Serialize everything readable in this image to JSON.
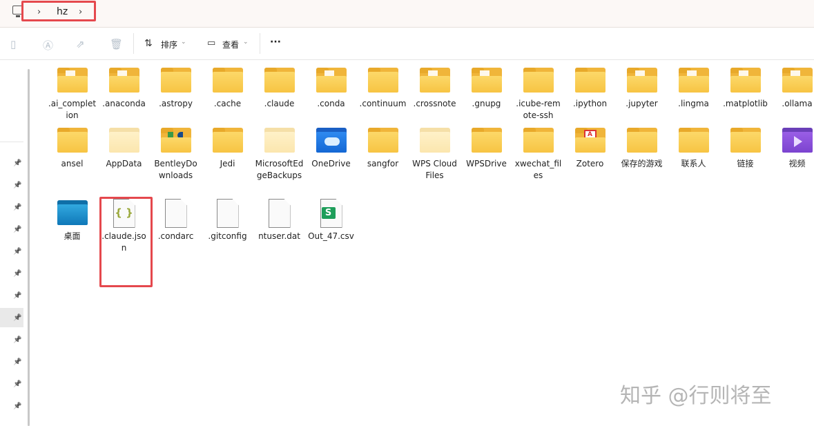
{
  "address": {
    "crumbs": [
      "hz"
    ]
  },
  "toolbar": {
    "sort_label": "排序",
    "view_label": "查看",
    "more_label": "···"
  },
  "items": [
    {
      "name": ".ai_completion",
      "type": "doc"
    },
    {
      "name": ".anaconda",
      "type": "doc"
    },
    {
      "name": ".astropy",
      "type": "folder"
    },
    {
      "name": ".cache",
      "type": "folder"
    },
    {
      "name": ".claude",
      "type": "folder"
    },
    {
      "name": ".conda",
      "type": "doc"
    },
    {
      "name": ".continuum",
      "type": "folder"
    },
    {
      "name": ".crossnote",
      "type": "doc"
    },
    {
      "name": ".gnupg",
      "type": "doc"
    },
    {
      "name": ".icube-remote-ssh",
      "type": "folder"
    },
    {
      "name": ".ipython",
      "type": "folder"
    },
    {
      "name": ".jupyter",
      "type": "doc"
    },
    {
      "name": ".lingma",
      "type": "doc"
    },
    {
      "name": ".matplotlib",
      "type": "doc"
    },
    {
      "name": ".ollama",
      "type": "doc"
    },
    {
      "name": "ansel",
      "type": "folder"
    },
    {
      "name": "AppData",
      "type": "pale"
    },
    {
      "name": "BentleyDownloads",
      "type": "bent"
    },
    {
      "name": "Jedi",
      "type": "folder"
    },
    {
      "name": "MicrosoftEdgeBackups",
      "type": "pale"
    },
    {
      "name": "OneDrive",
      "type": "onedrive"
    },
    {
      "name": "sangfor",
      "type": "folder"
    },
    {
      "name": "WPS Cloud Files",
      "type": "pale"
    },
    {
      "name": "WPSDrive",
      "type": "folder"
    },
    {
      "name": "xwechat_files",
      "type": "folder"
    },
    {
      "name": "Zotero",
      "type": "zot"
    },
    {
      "name": "保存的游戏",
      "type": "folder"
    },
    {
      "name": "联系人",
      "type": "folder"
    },
    {
      "name": "链接",
      "type": "folder"
    },
    {
      "name": "视频",
      "type": "video"
    },
    {
      "name": "桌面",
      "type": "desk"
    },
    {
      "name": ".claude.json",
      "type": "json",
      "glyph": "{ }"
    },
    {
      "name": ".condarc",
      "type": "file"
    },
    {
      "name": ".gitconfig",
      "type": "file"
    },
    {
      "name": "ntuser.dat",
      "type": "file"
    },
    {
      "name": "Out_47.csv",
      "type": "csv",
      "glyph": "S"
    }
  ],
  "watermark": "知乎 @行则将至"
}
